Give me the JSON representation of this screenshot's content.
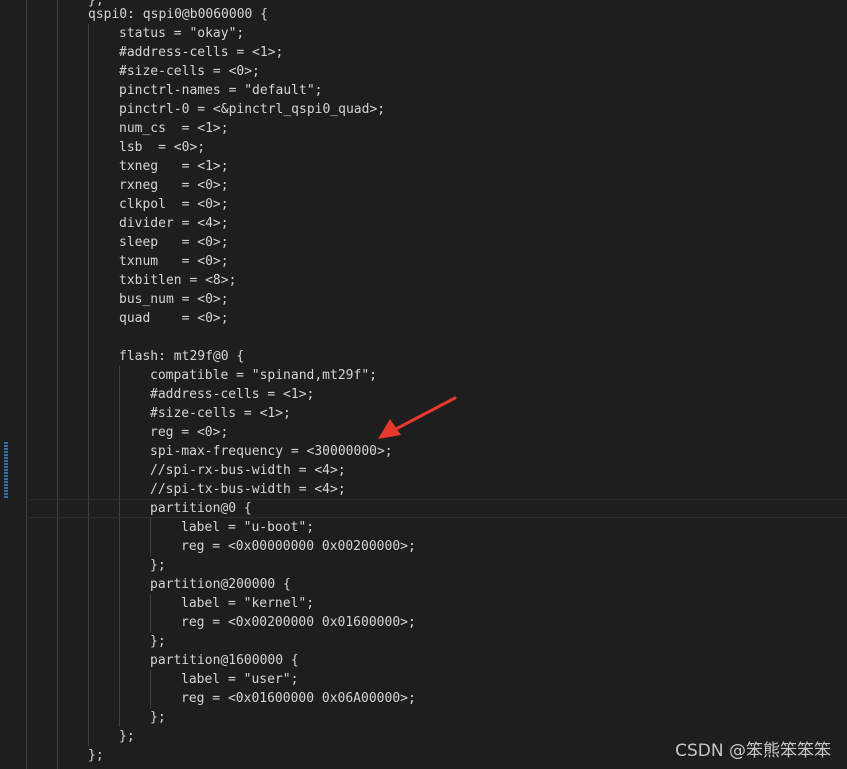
{
  "editor": {
    "lines": [
      "};",
      "qspi0: qspi0@b0060000 {",
      "status = \"okay\";",
      "#address-cells = <1>;",
      "#size-cells = <0>;",
      "pinctrl-names = \"default\";",
      "pinctrl-0 = <&pinctrl_qspi0_quad>;",
      "num_cs  = <1>;",
      "lsb  = <0>;",
      "txneg   = <1>;",
      "rxneg   = <0>;",
      "clkpol  = <0>;",
      "divider = <4>;",
      "sleep   = <0>;",
      "txnum   = <0>;",
      "txbitlen = <8>;",
      "bus_num = <0>;",
      "quad    = <0>;",
      "",
      "flash: mt29f@0 {",
      "compatible = \"spinand,mt29f\";",
      "#address-cells = <1>;",
      "#size-cells = <1>;",
      "reg = <0>;",
      "spi-max-frequency = <30000000>;",
      "//spi-rx-bus-width = <4>;",
      "//spi-tx-bus-width = <4>;",
      "partition@0 {",
      "label = \"u-boot\";",
      "reg = <0x00000000 0x00200000>;",
      "};",
      "partition@200000 {",
      "label = \"kernel\";",
      "reg = <0x00200000 0x01600000>;",
      "};",
      "partition@1600000 {",
      "label = \"user\";",
      "reg = <0x01600000 0x06A00000>;",
      "};",
      "};",
      "};"
    ]
  },
  "annotation": {
    "arrow_color": "#e8372c"
  },
  "watermark": {
    "text": "CSDN @笨熊笨笨笨"
  },
  "colors": {
    "background": "#1e1e1e",
    "text": "#d4d4d4",
    "indent_guide": "#404040",
    "gutter_change": "#2f6fb3"
  }
}
